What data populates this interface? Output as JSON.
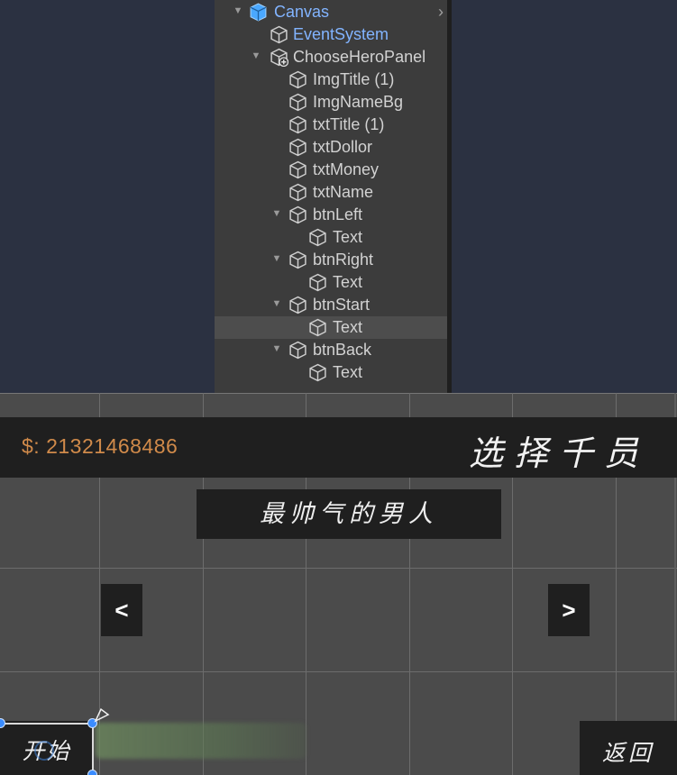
{
  "hierarchy": {
    "items": [
      {
        "label": "Canvas",
        "icon": "canvas-cube-icon",
        "color": "#82b4ff"
      },
      {
        "label": "EventSystem",
        "icon": "gameobject-cube-icon",
        "color": "#82b4ff"
      },
      {
        "label": "ChooseHeroPanel",
        "icon": "prefab-cube-icon"
      },
      {
        "label": "ImgTitle (1)",
        "icon": "gameobject-cube-icon"
      },
      {
        "label": "ImgNameBg",
        "icon": "gameobject-cube-icon"
      },
      {
        "label": "txtTitle (1)",
        "icon": "gameobject-cube-icon"
      },
      {
        "label": "txtDollor",
        "icon": "gameobject-cube-icon"
      },
      {
        "label": "txtMoney",
        "icon": "gameobject-cube-icon"
      },
      {
        "label": "txtName",
        "icon": "gameobject-cube-icon"
      },
      {
        "label": "btnLeft",
        "icon": "gameobject-cube-icon"
      },
      {
        "label": "Text",
        "icon": "gameobject-cube-icon"
      },
      {
        "label": "btnRight",
        "icon": "gameobject-cube-icon"
      },
      {
        "label": "Text",
        "icon": "gameobject-cube-icon"
      },
      {
        "label": "btnStart",
        "icon": "gameobject-cube-icon"
      },
      {
        "label": "Text",
        "icon": "gameobject-cube-icon",
        "selected": true
      },
      {
        "label": "btnBack",
        "icon": "gameobject-cube-icon"
      },
      {
        "label": "Text",
        "icon": "gameobject-cube-icon"
      }
    ]
  },
  "game": {
    "money": "$: 21321468486",
    "title": "选择千员",
    "hero_name": "最帅气的男人",
    "left_button": "<",
    "right_button": ">",
    "start_button": "开始",
    "back_button": "返回",
    "colors": {
      "panel": "#1f1f1f",
      "money": "#d08a4a",
      "background": "#4b4b4b",
      "selection_handle": "#3a8cff"
    }
  }
}
